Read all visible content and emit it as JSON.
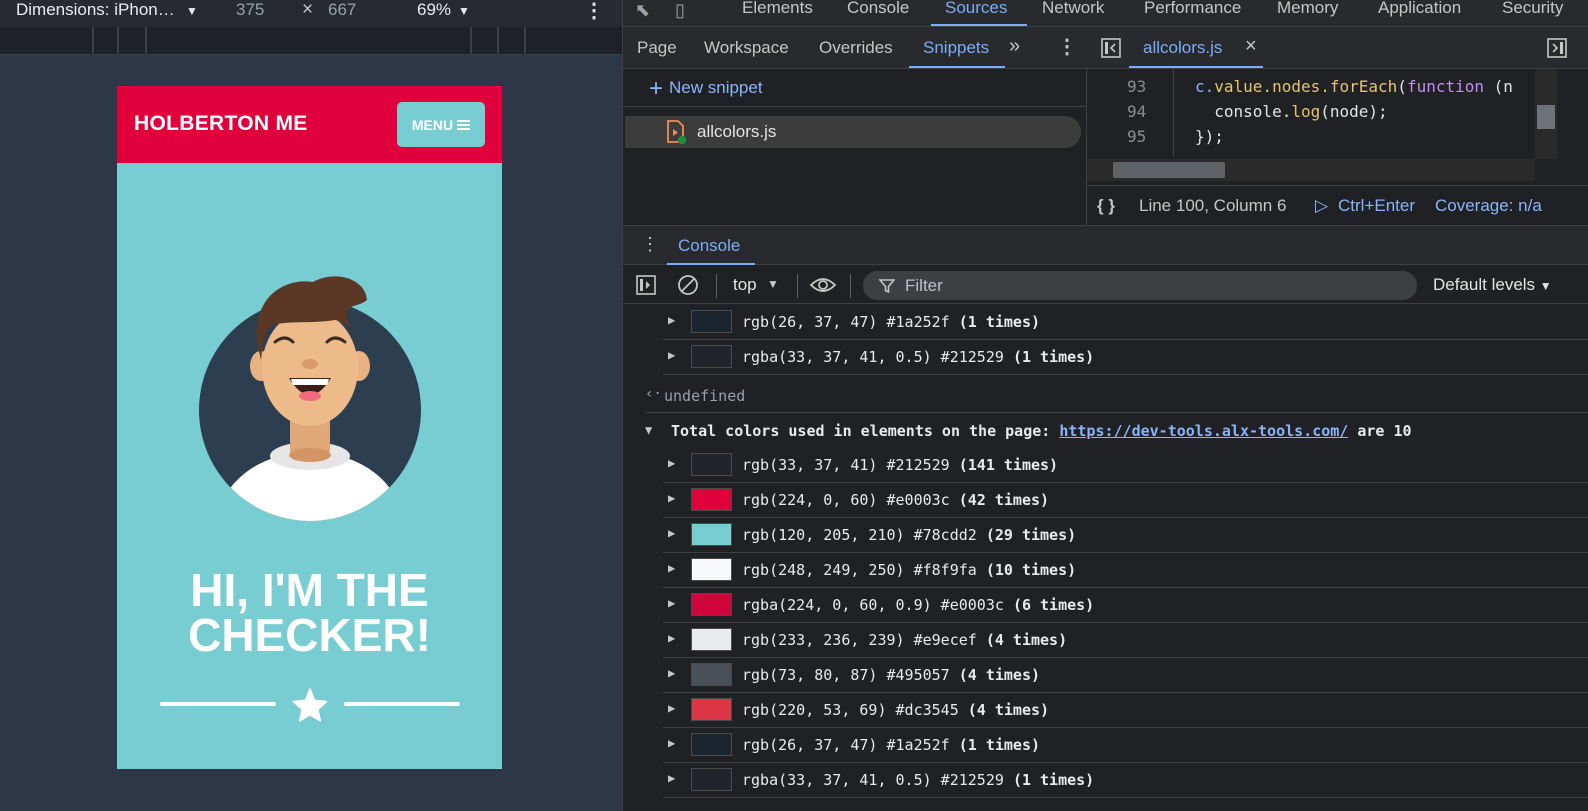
{
  "device_toolbar": {
    "dimensions_label": "Dimensions: iPhon…",
    "width": "375",
    "times": "×",
    "height": "667",
    "zoom": "69%"
  },
  "phone": {
    "brand": "HOLBERTON ME",
    "menu_label": "MENU",
    "hero_line1": "HI, I'M THE",
    "hero_line2": "CHECKER!"
  },
  "devtools_tabs": [
    "Elements",
    "Console",
    "Sources",
    "Network",
    "Performance",
    "Memory",
    "Application",
    "Security"
  ],
  "active_tab": "Sources",
  "navigator": {
    "tabs": [
      "Page",
      "Workspace",
      "Overrides",
      "Snippets"
    ],
    "active_tab": "Snippets",
    "new_snippet": "New snippet",
    "snippets": [
      "allcolors.js"
    ]
  },
  "editor": {
    "file_tab": "allcolors.js",
    "lines": [
      {
        "n": "93",
        "code": "c.value.nodes.forEach(function (n"
      },
      {
        "n": "94",
        "code": "  console.log(node);"
      },
      {
        "n": "95",
        "code": "});"
      }
    ],
    "status_position": "Line 100, Column 6",
    "run_hint": "Ctrl+Enter",
    "coverage": "Coverage: n/a"
  },
  "console": {
    "drawer_tab": "Console",
    "context": "top",
    "filter_placeholder": "Filter",
    "levels": "Default levels",
    "return_value": "undefined",
    "total_prefix": "Total colors used in elements on the page: ",
    "total_link": "https://dev-tools.alx-tools.com/",
    "total_suffix": " are 10",
    "earlier_entries": [
      {
        "value": "rgb(26, 37, 47) #1a252f",
        "count": "(1 times)",
        "swatch": "#1a252f"
      },
      {
        "value": "rgba(33, 37, 41, 0.5) #212529",
        "count": "(1 times)",
        "swatch": "#212529"
      }
    ],
    "entries": [
      {
        "value": "rgb(33, 37, 41) #212529",
        "count": "(141 times)",
        "swatch": "#212529"
      },
      {
        "value": "rgb(224, 0, 60) #e0003c",
        "count": "(42 times)",
        "swatch": "#e0003c"
      },
      {
        "value": "rgb(120, 205, 210) #78cdd2",
        "count": "(29 times)",
        "swatch": "#78cdd2"
      },
      {
        "value": "rgb(248, 249, 250) #f8f9fa",
        "count": "(10 times)",
        "swatch": "#f8f9fa"
      },
      {
        "value": "rgba(224, 0, 60, 0.9) #e0003c",
        "count": "(6 times)",
        "swatch": "#d0063b"
      },
      {
        "value": "rgb(233, 236, 239) #e9ecef",
        "count": "(4 times)",
        "swatch": "#e9ecef"
      },
      {
        "value": "rgb(73, 80, 87) #495057",
        "count": "(4 times)",
        "swatch": "#495057"
      },
      {
        "value": "rgb(220, 53, 69) #dc3545",
        "count": "(4 times)",
        "swatch": "#dc3545"
      },
      {
        "value": "rgb(26, 37, 47) #1a252f",
        "count": "(1 times)",
        "swatch": "#1a252f"
      },
      {
        "value": "rgba(33, 37, 41, 0.5) #212529",
        "count": "(1 times)",
        "swatch": "#212529"
      }
    ]
  }
}
